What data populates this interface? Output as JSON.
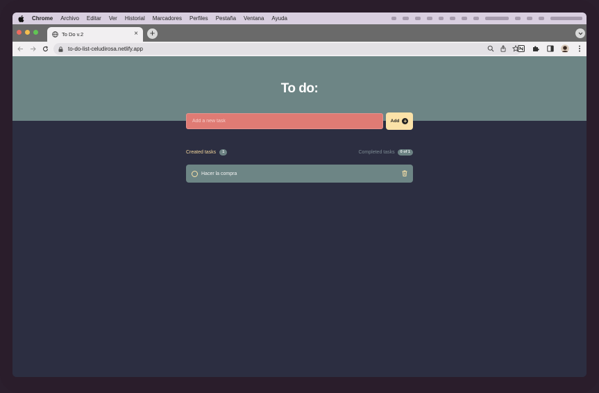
{
  "menubar": {
    "items": [
      "Chrome",
      "Archivo",
      "Editar",
      "Ver",
      "Historial",
      "Marcadores",
      "Perfiles",
      "Pestaña",
      "Ventana",
      "Ayuda"
    ]
  },
  "browser": {
    "tab_title": "To Do v.2",
    "tab_close": "×",
    "new_tab": "+",
    "url": "to-do-list-celudirosa.netlify.app"
  },
  "app": {
    "title": "To do:",
    "input_placeholder": "Add a new task",
    "add_label": "Add",
    "created_label": "Created tasks",
    "created_count": "1",
    "completed_label": "Completed tasks",
    "completed_count": "0 of 1",
    "tasks": [
      {
        "text": "Hacer la compra",
        "done": false
      }
    ]
  },
  "colors": {
    "hero": "#6d8585",
    "background": "#2c2e41",
    "input": "#e07b74",
    "add_button": "#fbe2a8",
    "accent_text": "#f1d49a"
  },
  "icons": {
    "apple": "apple-icon",
    "globe": "globe-icon",
    "lock": "lock-icon",
    "trash": "trash-icon",
    "check": "circle-check-icon"
  }
}
